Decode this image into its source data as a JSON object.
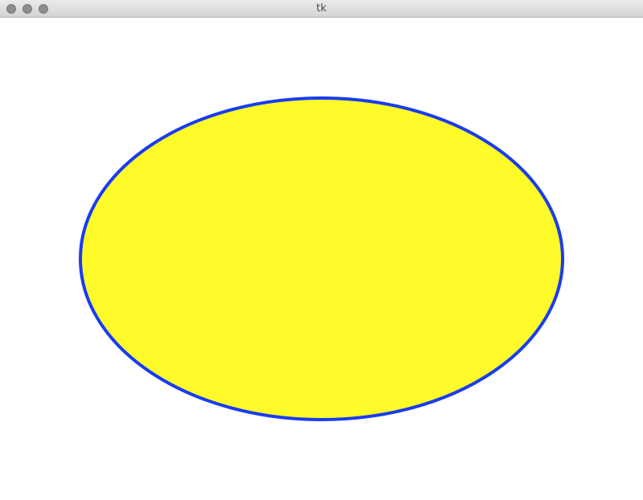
{
  "window": {
    "title": "tk"
  },
  "titlebar": {
    "buttons": [
      {
        "name": "close-button",
        "color": "#8d8d91"
      },
      {
        "name": "minimize-button",
        "color": "#8d8d91"
      },
      {
        "name": "zoom-button",
        "color": "#8d8d91"
      }
    ]
  },
  "canvas": {
    "background": "#ffffff",
    "shapes": [
      {
        "type": "oval",
        "fill": "#fffa2a",
        "outline": "#1a3cf0"
      }
    ]
  }
}
